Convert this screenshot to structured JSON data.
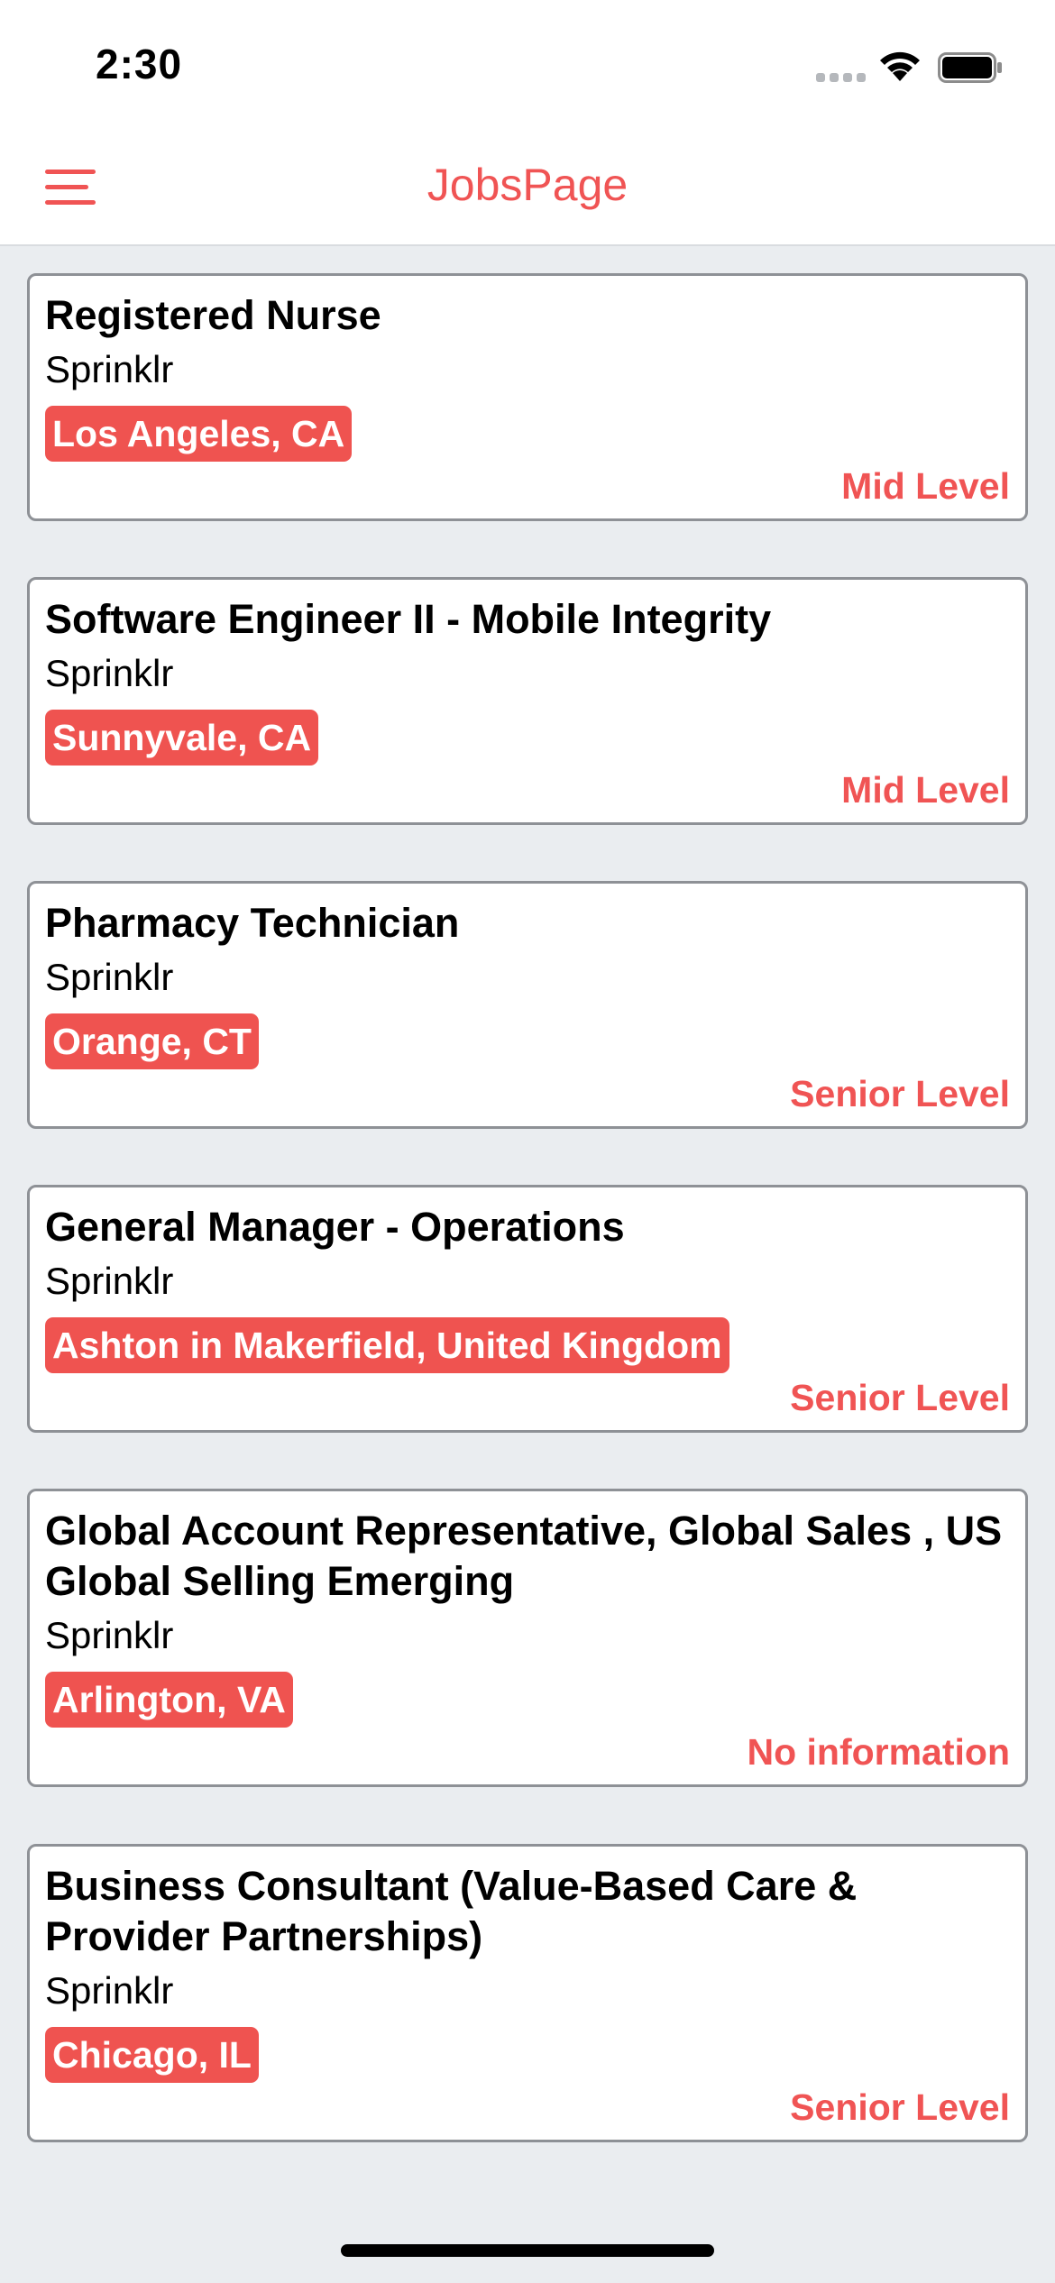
{
  "status_bar": {
    "time": "2:30"
  },
  "header": {
    "title": "JobsPage",
    "menu_icon": "hamburger-menu-icon"
  },
  "colors": {
    "accent": "#f05454",
    "badge": "#ef5350",
    "background": "#eaedf0"
  },
  "jobs": [
    {
      "title": "Registered Nurse",
      "company": "Sprinklr",
      "location": "Los Angeles, CA",
      "level": "Mid Level"
    },
    {
      "title": "Software Engineer II - Mobile Integrity",
      "company": "Sprinklr",
      "location": "Sunnyvale, CA",
      "level": "Mid Level"
    },
    {
      "title": "Pharmacy Technician",
      "company": "Sprinklr",
      "location": "Orange, CT",
      "level": "Senior Level"
    },
    {
      "title": "General Manager - Operations",
      "company": "Sprinklr",
      "location": "Ashton in Makerfield, United Kingdom",
      "level": "Senior Level"
    },
    {
      "title": "Global Account Representative, Global Sales , US Global Selling Emerging",
      "company": "Sprinklr",
      "location": "Arlington, VA",
      "level": "No information"
    },
    {
      "title": "Business Consultant (Value-Based Care & Provider Partnerships)",
      "company": "Sprinklr",
      "location": "Chicago, IL",
      "level": "Senior Level"
    }
  ]
}
